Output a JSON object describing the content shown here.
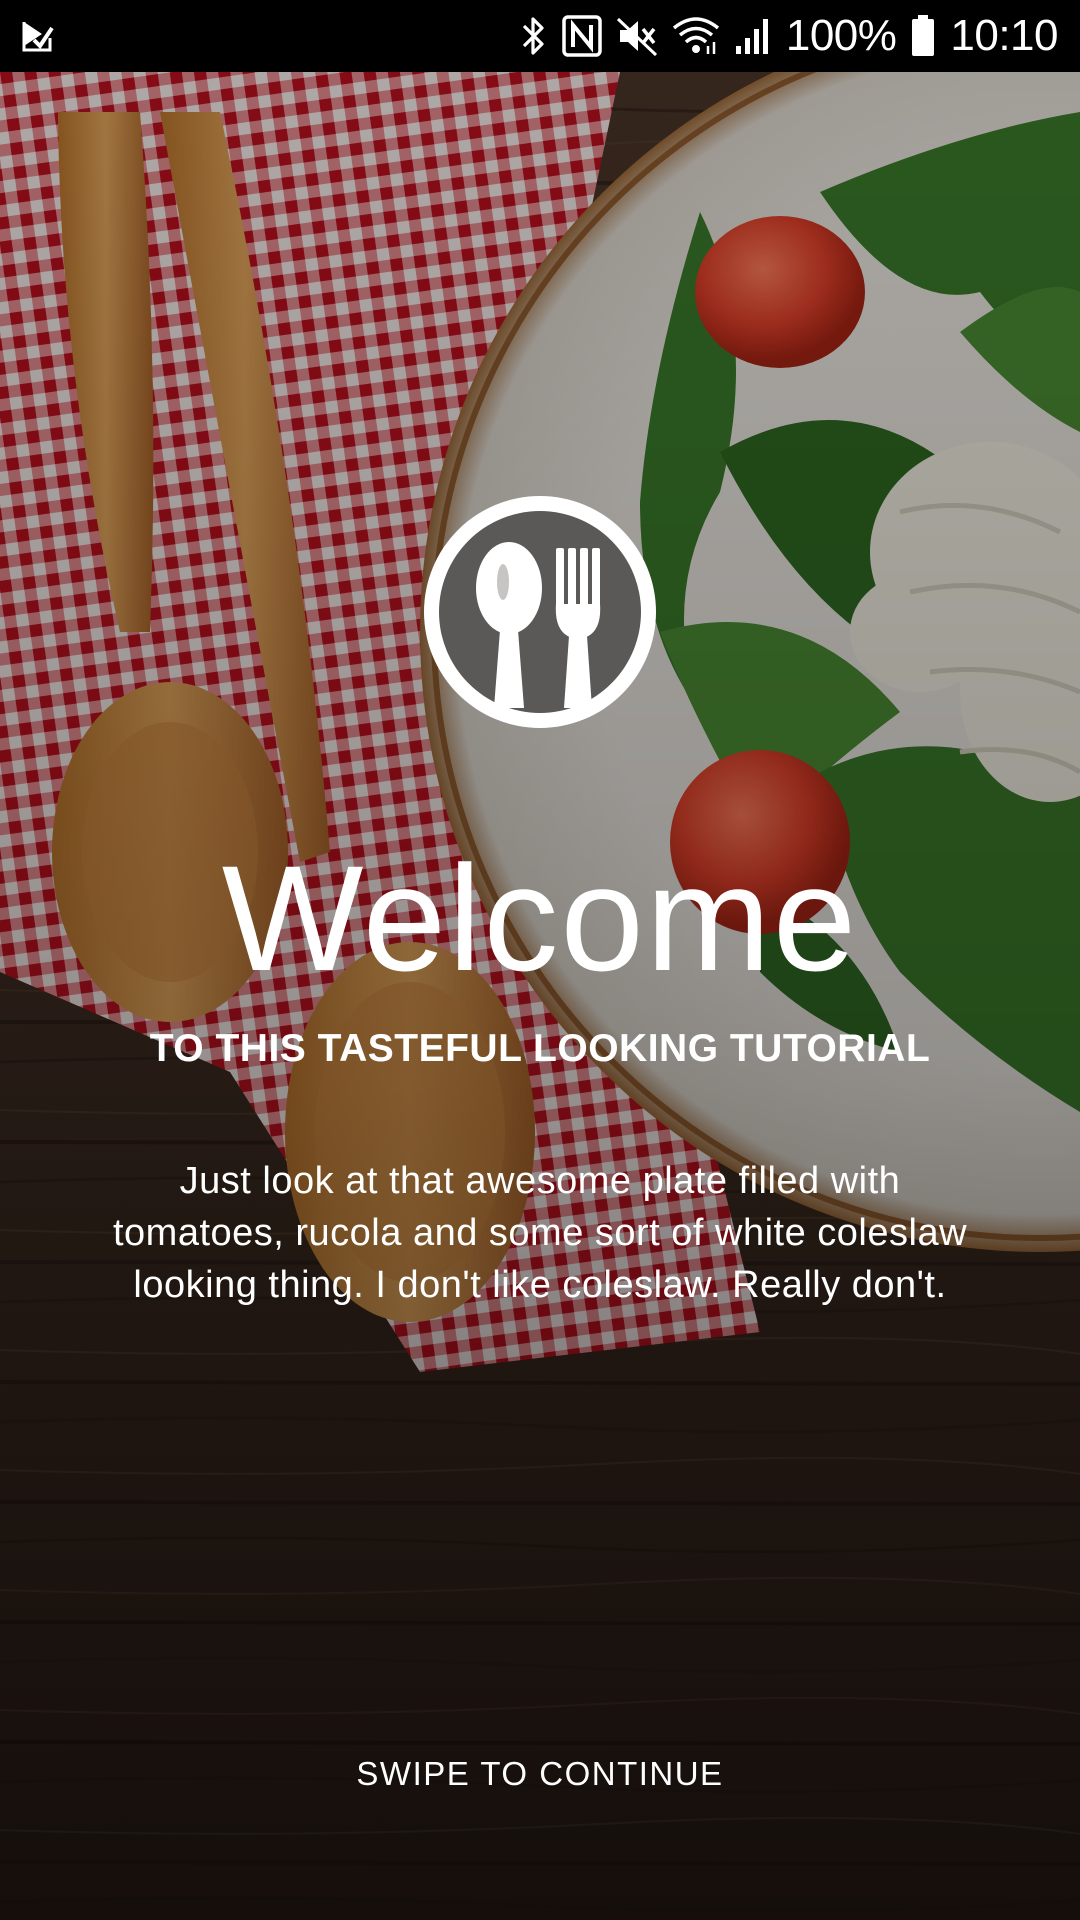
{
  "status_bar": {
    "battery_percent": "100%",
    "time": "10:10",
    "icons": [
      "app-notification-icon",
      "bluetooth-icon",
      "nfc-icon",
      "mute-icon",
      "wifi-icon",
      "signal-icon",
      "battery-icon"
    ]
  },
  "splash": {
    "logo_icon": "spoon-fork-icon",
    "title": "Welcome",
    "subtitle": "TO THIS TASTEFUL LOOKING TUTORIAL",
    "body": "Just look at that awesome plate filled with tomatoes, rucola and some sort of white coleslaw looking thing. I don't like coleslaw. Really don't.",
    "swipe_hint": "SWIPE TO CONTINUE"
  },
  "colors": {
    "text": "#ffffff",
    "status_bar_bg": "#000000",
    "wood": "#3b2a20",
    "checker_red": "#c8202c",
    "plate": "#e8e4de",
    "tomato": "#d9412a",
    "greens": "#3f7a2c"
  }
}
